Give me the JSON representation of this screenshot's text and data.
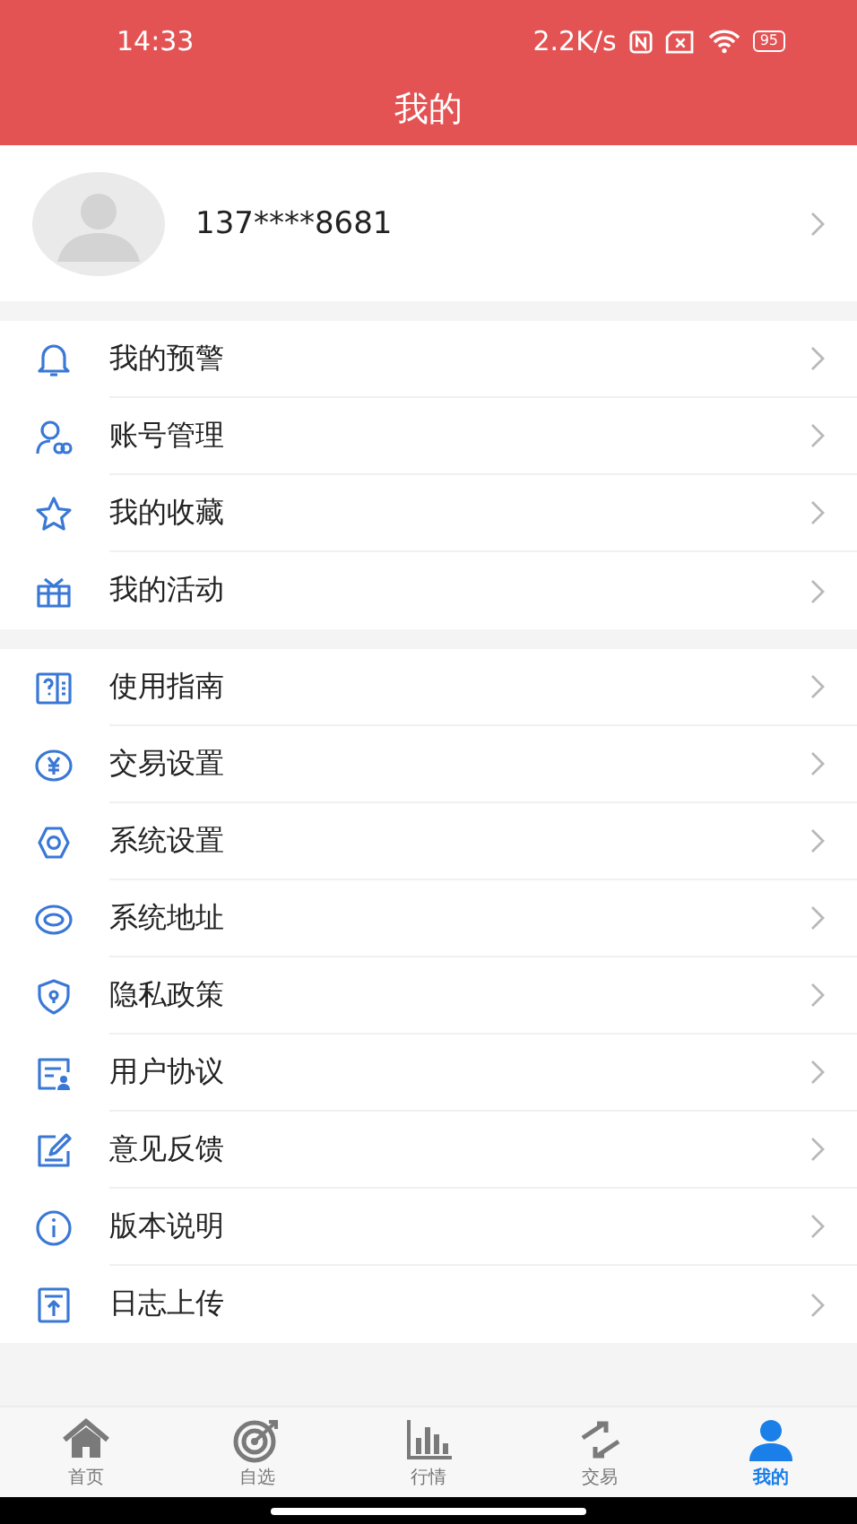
{
  "status_bar": {
    "time": "14:33",
    "speed": "2.2K/s",
    "battery": "95"
  },
  "title": "我的",
  "profile": {
    "phone": "137****8681"
  },
  "groups": [
    {
      "items": [
        {
          "label": "我的预警"
        },
        {
          "label": "账号管理"
        },
        {
          "label": "我的收藏"
        },
        {
          "label": "我的活动"
        }
      ]
    },
    {
      "items": [
        {
          "label": "使用指南"
        },
        {
          "label": "交易设置"
        },
        {
          "label": "系统设置"
        },
        {
          "label": "系统地址"
        },
        {
          "label": "隐私政策"
        },
        {
          "label": "用户协议"
        },
        {
          "label": "意见反馈"
        },
        {
          "label": "版本说明"
        },
        {
          "label": "日志上传"
        }
      ]
    }
  ],
  "tabs": [
    {
      "label": "首页",
      "selected": false
    },
    {
      "label": "自选",
      "selected": false
    },
    {
      "label": "行情",
      "selected": false
    },
    {
      "label": "交易",
      "selected": false
    },
    {
      "label": "我的",
      "selected": true
    }
  ]
}
